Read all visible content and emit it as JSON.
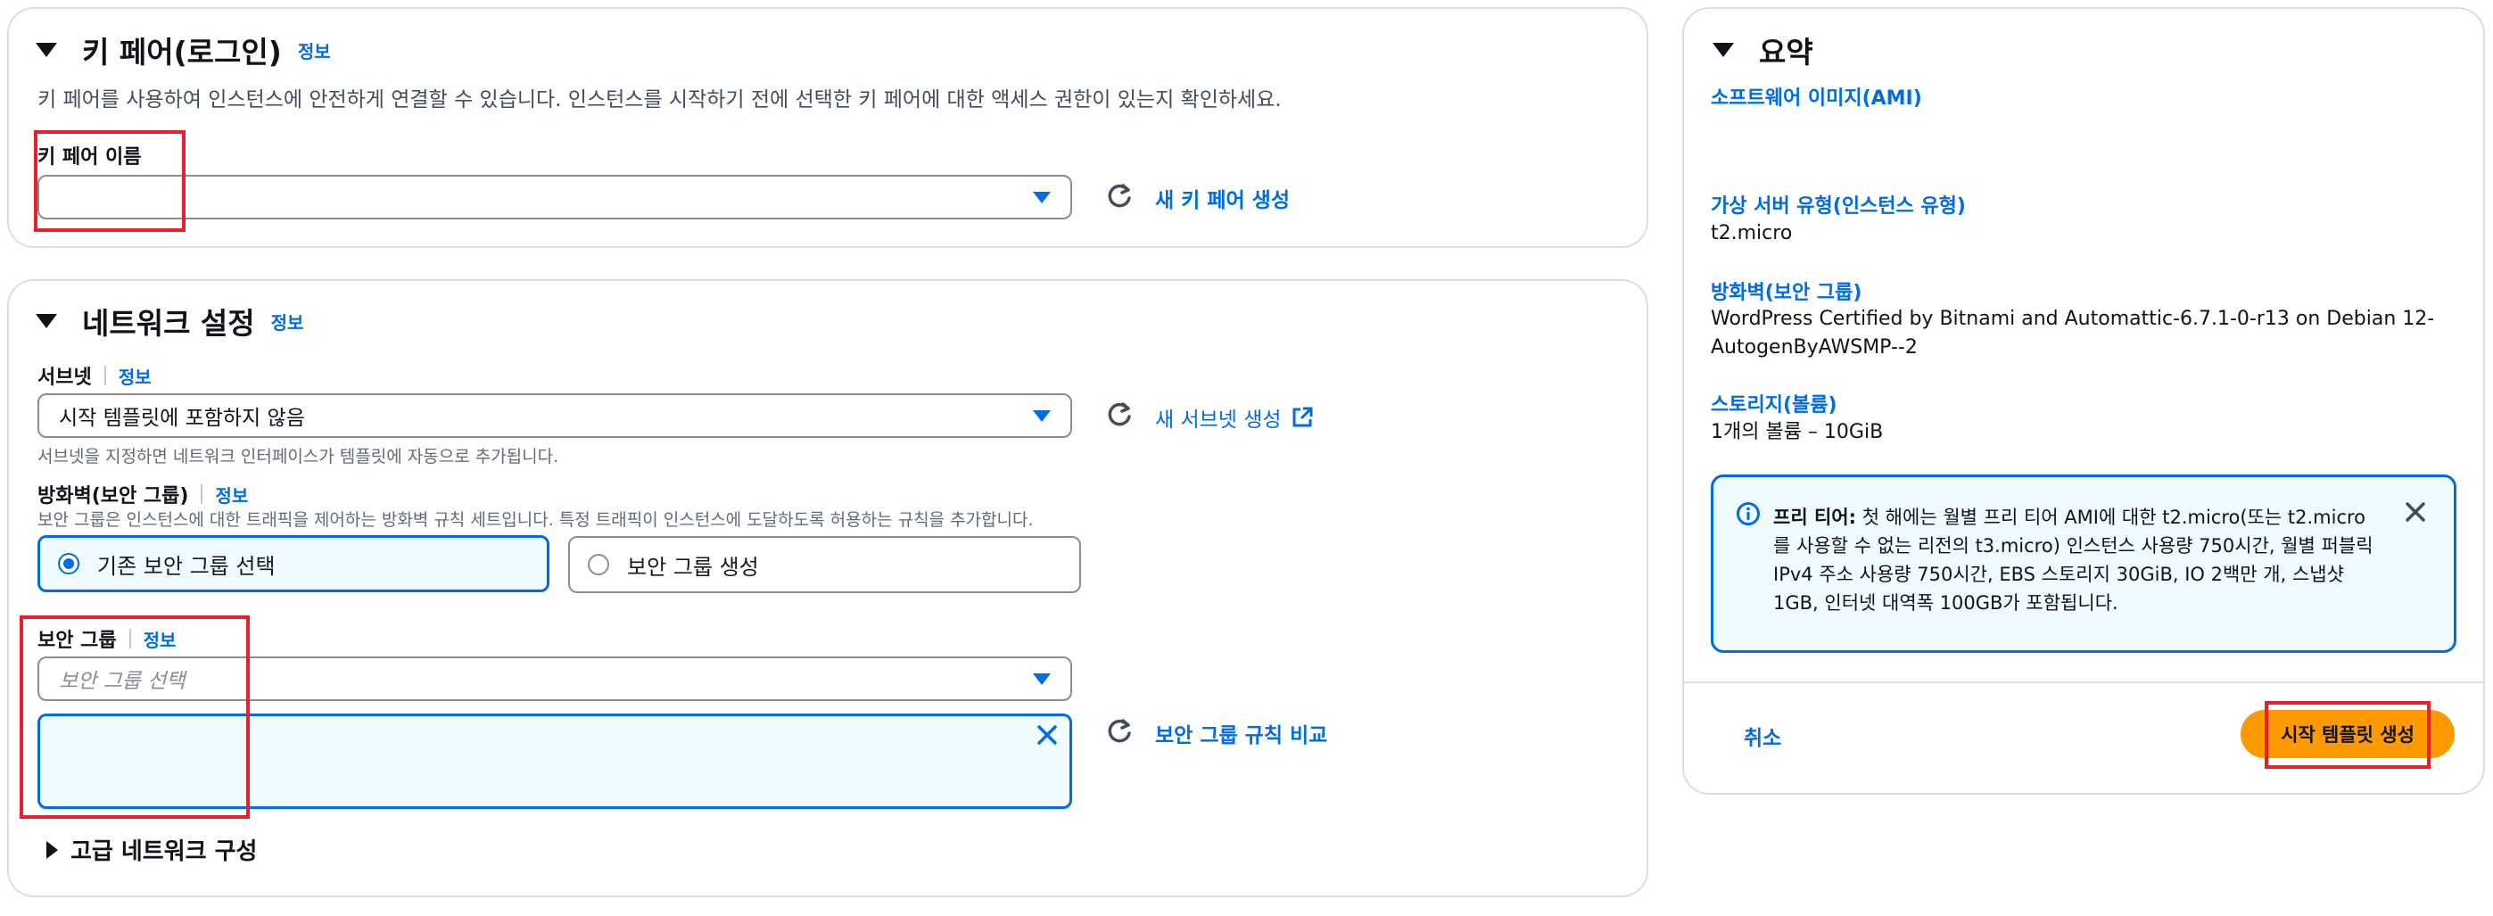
{
  "key_pair": {
    "title": "키 페어(로그인)",
    "info": "정보",
    "description": "키 페어를 사용하여 인스턴스에 안전하게 연결할 수 있습니다. 인스턴스를 시작하기 전에 선택한 키 페어에 대한 액세스 권한이 있는지 확인하세요.",
    "field_label": "키 페어 이름",
    "field_value": "",
    "create_link": "새 키 페어 생성"
  },
  "network": {
    "title": "네트워크 설정",
    "info": "정보",
    "subnet": {
      "label": "서브넷",
      "info": "정보",
      "value": "시작 템플릿에 포함하지 않음",
      "hint": "서브넷을 지정하면 네트워크 인터페이스가 템플릿에 자동으로 추가됩니다.",
      "create_link": "새 서브넷 생성"
    },
    "firewall": {
      "label": "방화벽(보안 그룹)",
      "info": "정보",
      "hint": "보안 그룹은 인스턴스에 대한 트래픽을 제어하는 방화벽 규칙 세트입니다. 특정 트래픽이 인스턴스에 도달하도록 허용하는 규칙을 추가합니다.",
      "options": [
        "기존 보안 그룹 선택",
        "보안 그룹 생성"
      ],
      "selected": "기존 보안 그룹 선택"
    },
    "security_group": {
      "label": "보안 그룹",
      "info": "정보",
      "placeholder": "보안 그룹 선택",
      "compare_link": "보안 그룹 규칙 비교"
    },
    "advanced": "고급 네트워크 구성"
  },
  "summary": {
    "title": "요약",
    "ami_label": "소프트웨어 이미지(AMI)",
    "instance_type_label": "가상 서버 유형(인스턴스 유형)",
    "instance_type_value": "t2.micro",
    "firewall_label": "방화벽(보안 그룹)",
    "firewall_value": "WordPress Certified by Bitnami and Automattic-6.7.1-0-r13 on Debian 12-AutogenByAWSMP--2",
    "storage_label": "스토리지(볼륨)",
    "storage_value": "1개의 볼륨 – 10GiB",
    "free_tier_title": "프리 티어:",
    "free_tier_text": "첫 해에는 월별 프리 티어 AMI에 대한 t2.micro(또는 t2.micro를 사용할 수 없는 리전의 t3.micro) 인스턴스 사용량 750시간, 월별 퍼블릭 IPv4 주소 사용량 750시간, EBS 스토리지 30GiB, IO 2백만 개, 스냅샷 1GB, 인터넷 대역폭 100GB가 포함됩니다.",
    "cancel": "취소",
    "create": "시작 템플릿 생성"
  },
  "colors": {
    "link": "#006ce0",
    "primary_button": "#ff9900",
    "highlight_box": "#e8202c"
  }
}
